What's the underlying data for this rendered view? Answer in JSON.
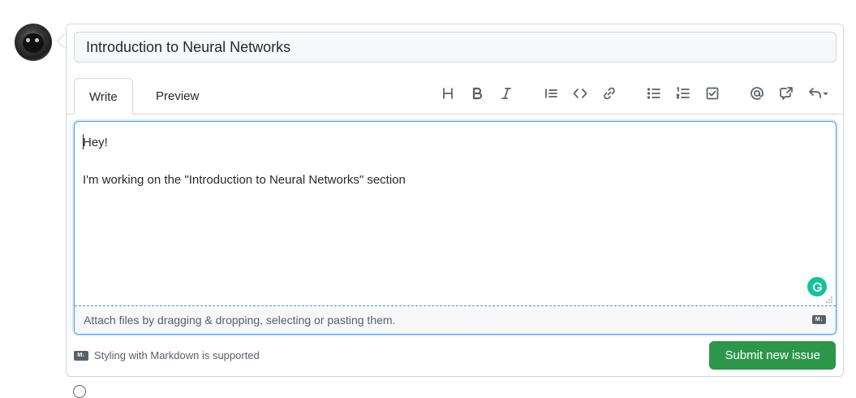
{
  "issue": {
    "title": "Introduction to Neural Networks"
  },
  "tabs": [
    {
      "label": "Write"
    },
    {
      "label": "Preview"
    }
  ],
  "toolbar": {
    "icons": [
      "heading-icon",
      "bold-icon",
      "italic-icon",
      "quote-icon",
      "code-icon",
      "link-icon",
      "unordered-list-icon",
      "ordered-list-icon",
      "task-list-icon",
      "mention-icon",
      "reference-icon",
      "reply-icon"
    ]
  },
  "editor": {
    "lines": [
      "Hey!",
      "",
      "I'm working on the \"Introduction to Neural Networks\" section"
    ],
    "attach_text": "Attach files by dragging & dropping, selecting or pasting them.",
    "md_badge": "M↓"
  },
  "footer": {
    "markdown_note": "Styling with Markdown is supported",
    "submit_label": "Submit new issue"
  },
  "colors": {
    "submit_bg": "#2c974b",
    "focus_border": "#5a9ad8",
    "grammarly": "#15c39a"
  }
}
